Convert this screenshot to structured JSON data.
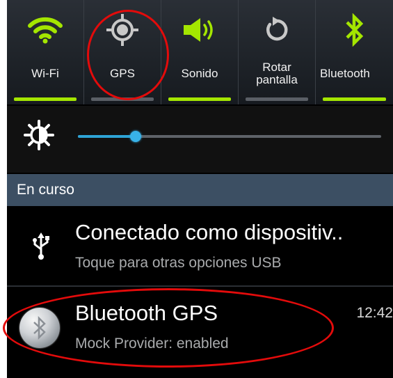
{
  "quick_settings": {
    "tiles": [
      {
        "label": "Wi-Fi",
        "icon": "wifi-icon",
        "active": true
      },
      {
        "label": "GPS",
        "icon": "gps-icon",
        "active": false
      },
      {
        "label": "Sonido",
        "icon": "sound-icon",
        "active": true
      },
      {
        "label": "Rotar\npantalla",
        "icon": "rotate-icon",
        "active": false
      },
      {
        "label": "Bluetooth",
        "icon": "bluetooth-icon",
        "active": true
      }
    ]
  },
  "brightness": {
    "icon": "brightness-icon",
    "level": 0.19
  },
  "section": {
    "title": "En curso"
  },
  "notifications": [
    {
      "title": "Conectado como dispositiv..",
      "subtitle": "Toque para otras opciones USB",
      "icon": "usb-icon",
      "time": ""
    },
    {
      "title": "Bluetooth GPS",
      "subtitle": "Mock Provider: enabled",
      "icon": "bluetooth-gps-icon",
      "time": "12:42"
    }
  ],
  "colors": {
    "active_green": "#a4e600",
    "slider_blue": "#2ea4d6",
    "section_bg": "#3c4f63",
    "annotation_red": "#e30b0b"
  }
}
